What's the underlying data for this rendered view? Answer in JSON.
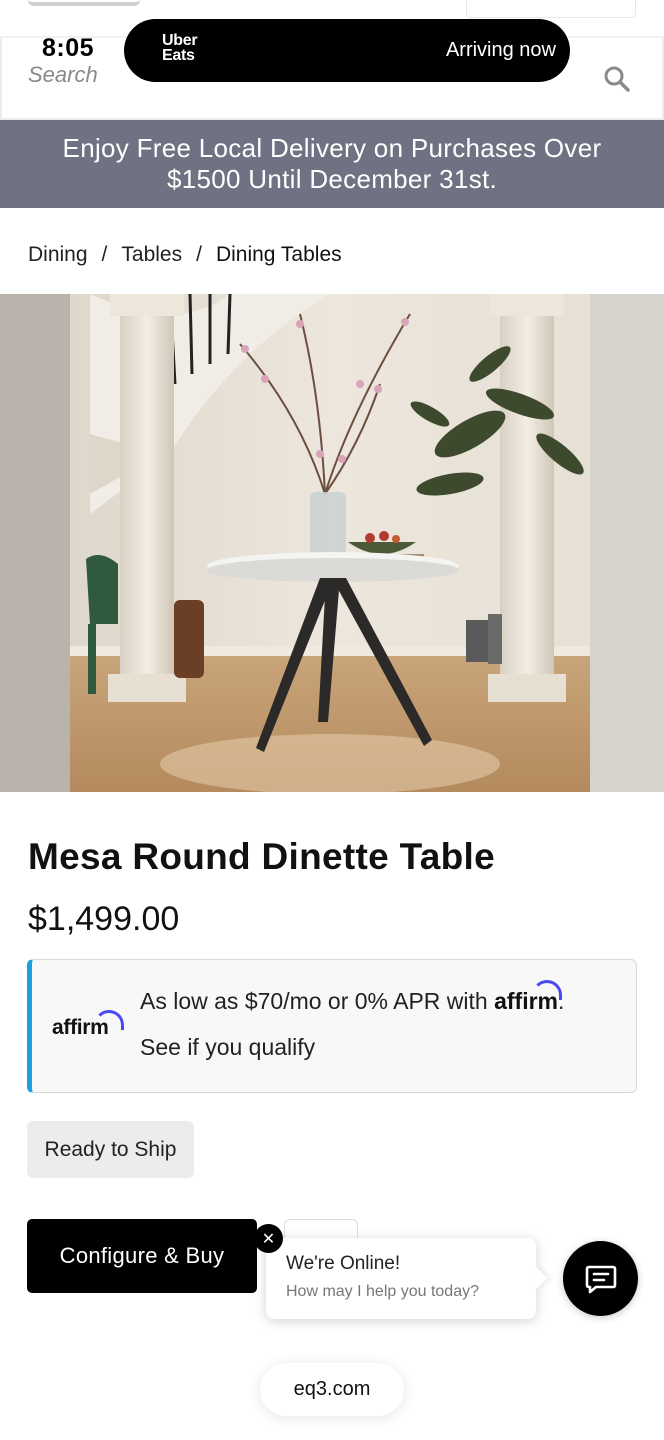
{
  "status_bar": {
    "time": "8:05"
  },
  "search": {
    "placeholder": "Search",
    "icon": "search-icon"
  },
  "uber_eats": {
    "logo_line1": "Uber",
    "logo_line2": "Eats",
    "status": "Arriving now"
  },
  "promo_banner": {
    "line1": "Enjoy Free Local Delivery on Purchases Over",
    "line2": "$1500 Until December 31st."
  },
  "breadcrumb": {
    "items": [
      {
        "label": "Dining"
      },
      {
        "label": "Tables"
      },
      {
        "label": "Dining Tables"
      }
    ],
    "separator": "/"
  },
  "product": {
    "title": "Mesa Round Dinette Table",
    "price": "$1,499.00",
    "badge": "Ready to Ship",
    "cta": "Configure & Buy"
  },
  "affirm": {
    "logo": "affirm",
    "line1_prefix": "As low as $70/mo or 0% APR with ",
    "line1_brand": "affirm",
    "line1_suffix": ".",
    "line2": "See if you qualify",
    "accent_color": "#1aa0e0"
  },
  "chat": {
    "title": "We're Online!",
    "subtitle": "How may I help you today?",
    "close_icon": "close-icon",
    "launcher_icon": "chat-icon"
  },
  "browser": {
    "url": "eq3.com"
  },
  "colors": {
    "promo_bg": "#6f7282",
    "primary_button": "#000000",
    "badge_bg": "#ececec"
  }
}
